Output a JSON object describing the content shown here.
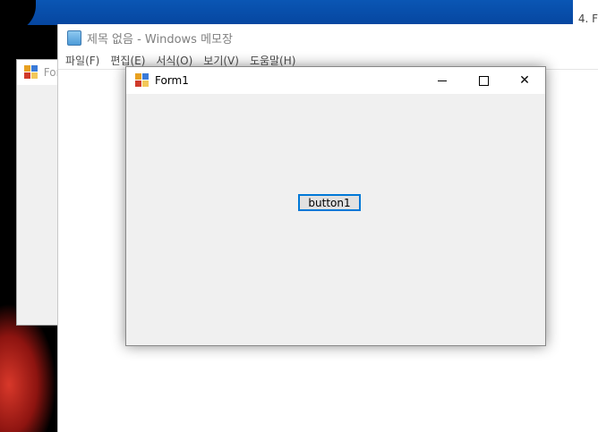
{
  "desktop": {
    "right_clip_text": "4. F"
  },
  "background_form": {
    "title": "Form"
  },
  "notepad": {
    "title": "제목 없음 - Windows 메모장",
    "menu": [
      "파일(F)",
      "편집(E)",
      "서식(O)",
      "보기(V)",
      "도움말(H)"
    ]
  },
  "form1": {
    "title": "Form1",
    "controls": {
      "close": "✕"
    },
    "button1_label": "button1"
  },
  "colors": {
    "accent": "#0078d7",
    "form_bg": "#f0f0f0",
    "desktop_blue": "#0a56b4"
  }
}
